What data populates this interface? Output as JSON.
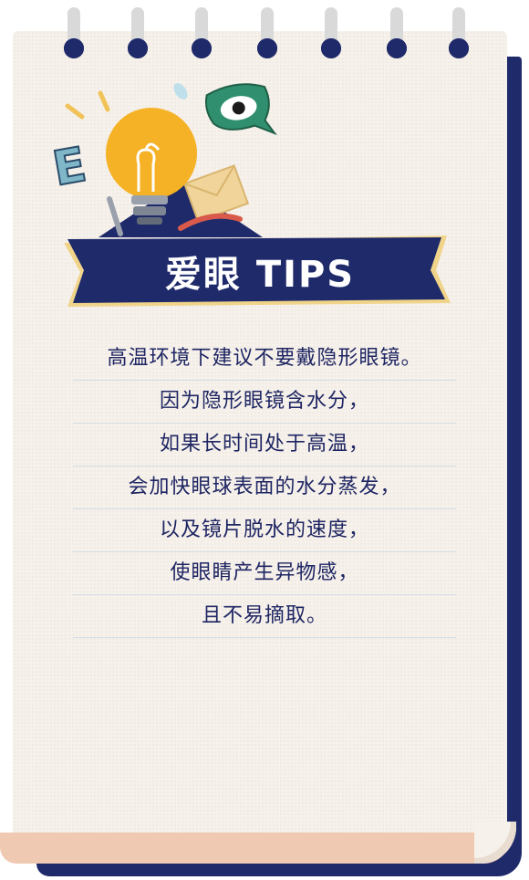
{
  "banner": {
    "title": "爱眼 TIPS"
  },
  "illustration": {
    "letter": "E"
  },
  "tips": [
    "高温环境下建议不要戴隐形眼镜。",
    "因为隐形眼镜含水分，",
    "如果长时间处于高温，",
    "会加快眼球表面的水分蒸发，",
    "以及镜片脱水的速度，",
    "使眼睛产生异物感，",
    "且不易摘取。"
  ],
  "colors": {
    "navy": "#1f2a6b",
    "paper": "#f6f1ea",
    "bulb": "#f5b226",
    "eye_bubble": "#2f8f6e",
    "text": "#1e2563"
  }
}
